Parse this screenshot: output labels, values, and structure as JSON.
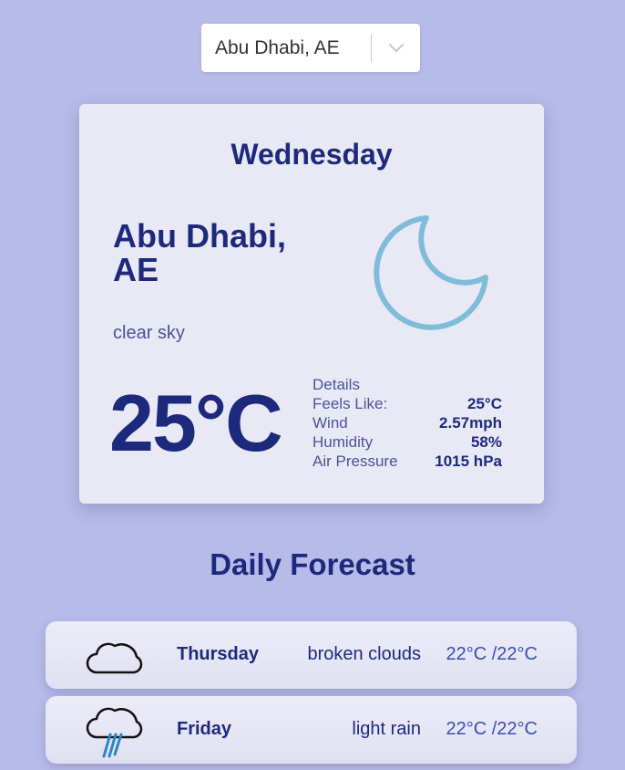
{
  "city_select": {
    "value": "Abu Dhabi, AE",
    "icon": "chevron-down-icon"
  },
  "current": {
    "day": "Wednesday",
    "city_line1": "Abu Dhabi,",
    "city_line2": "AE",
    "description": "clear sky",
    "icon": "moon-icon",
    "temperature": "25°C",
    "details": {
      "title": "Details",
      "feels_like_label": "Feels Like:",
      "feels_like_value": "25°C",
      "wind_label": "Wind",
      "wind_value": "2.57mph",
      "humidity_label": "Humidity",
      "humidity_value": "58%",
      "pressure_label": "Air Pressure",
      "pressure_value": "1015 hPa"
    }
  },
  "forecast": {
    "title": "Daily Forecast",
    "items": [
      {
        "day": "Thursday",
        "description": "broken clouds",
        "temp": "22°C /22°C",
        "icon": "cloud-icon"
      },
      {
        "day": "Friday",
        "description": "light rain",
        "temp": "22°C /22°C",
        "icon": "rain-cloud-icon"
      }
    ]
  },
  "colors": {
    "background": "#b6bbe9",
    "card": "#e9e9f6",
    "primary_text": "#1d2a7c",
    "secondary_text": "#4a5296",
    "moon_icon": "#7fbcd9"
  }
}
